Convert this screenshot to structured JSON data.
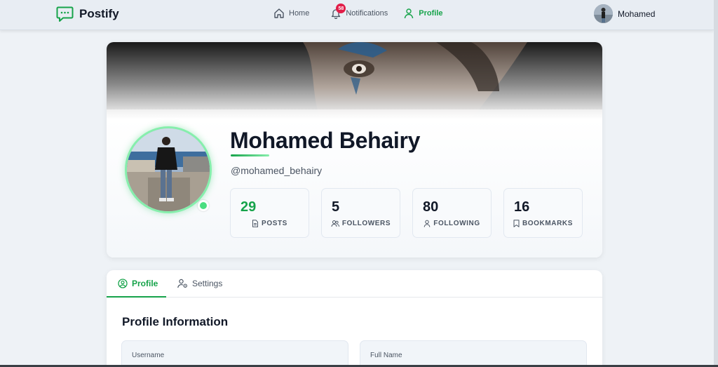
{
  "app": {
    "name": "Postify",
    "accent": "#16a34a"
  },
  "nav": {
    "home_label": "Home",
    "notifications_label": "Notifications",
    "notifications_count": "58",
    "profile_label": "Profile",
    "user_name": "Mohamed"
  },
  "profile": {
    "display_name": "Mohamed Behairy",
    "handle": "@mohamed_behairy",
    "online": true,
    "stats": [
      {
        "value": "29",
        "label": "POSTS",
        "icon": "document-icon"
      },
      {
        "value": "5",
        "label": "FOLLOWERS",
        "icon": "users-icon"
      },
      {
        "value": "80",
        "label": "FOLLOWING",
        "icon": "user-icon"
      },
      {
        "value": "16",
        "label": "BOOKMARKS",
        "icon": "bookmark-icon"
      }
    ]
  },
  "tabs": [
    {
      "label": "Profile",
      "icon": "user-circle-icon",
      "active": true
    },
    {
      "label": "Settings",
      "icon": "user-gear-icon",
      "active": false
    }
  ],
  "section": {
    "title": "Profile Information",
    "fields": [
      {
        "label": "Username"
      },
      {
        "label": "Full Name"
      }
    ]
  }
}
